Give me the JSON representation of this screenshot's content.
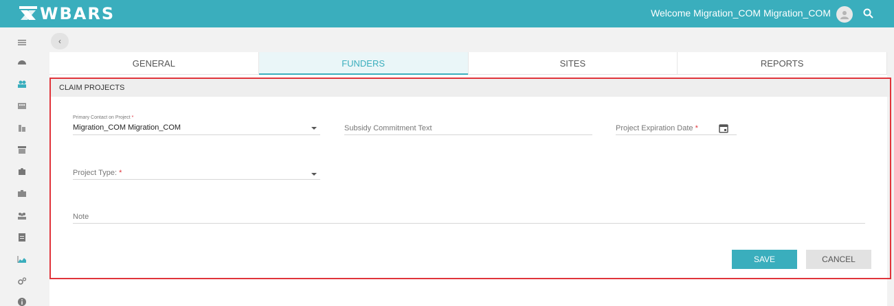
{
  "header": {
    "brand": "WBARS",
    "welcome_text": "Welcome Migration_COM Migration_COM",
    "accent_color": "#3aaebd"
  },
  "sidebar": {
    "icons": [
      "menu-icon",
      "dashboard-icon",
      "people-icon",
      "building-icon",
      "city-icon",
      "store-icon",
      "puzzle-icon",
      "briefcase-icon",
      "group-icon",
      "document-icon",
      "chart-icon",
      "settings-icon",
      "info-icon"
    ]
  },
  "tabs": [
    {
      "label": "GENERAL",
      "active": false
    },
    {
      "label": "FUNDERS",
      "active": true
    },
    {
      "label": "SITES",
      "active": false
    },
    {
      "label": "REPORTS",
      "active": false
    }
  ],
  "section": {
    "title": "CLAIM PROJECTS"
  },
  "form": {
    "primary_contact_label": "Primary Contact on Project",
    "primary_contact_value": "Migration_COM Migration_COM",
    "subsidy_placeholder": "Subsidy Commitment Text",
    "expiration_label": "Project Expiration Date",
    "project_type_label": "Project Type:",
    "note_placeholder": "Note",
    "required_marker": "*"
  },
  "actions": {
    "save_label": "SAVE",
    "cancel_label": "CANCEL"
  }
}
